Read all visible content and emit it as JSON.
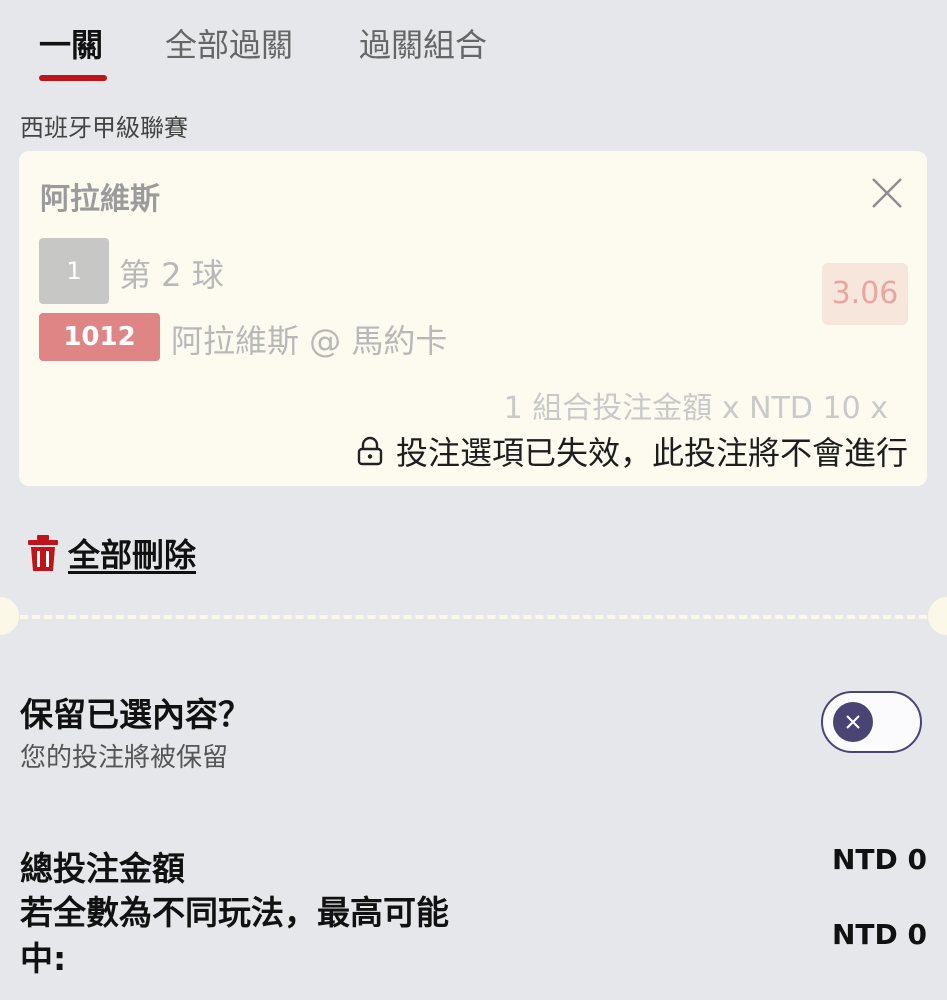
{
  "tabs": [
    {
      "label": "一關",
      "active": true
    },
    {
      "label": "全部過關",
      "active": false
    },
    {
      "label": "過關組合",
      "active": false
    }
  ],
  "league": "西班牙甲級聯賽",
  "bet_card": {
    "team": "阿拉維斯",
    "selection_badge": "1",
    "selection_text": "第 2 球",
    "odds": "3.06",
    "match_code": "1012",
    "match_text": "阿拉維斯 @ 馬約卡",
    "stake_line": "1 組合投注金額 x NTD 10 x",
    "invalid_notice": "投注選項已失效，此投注將不會進行"
  },
  "delete_all_label": "全部刪除",
  "keep_selection": {
    "title": "保留已選內容？",
    "subtitle": "您的投注將被保留",
    "toggle_on": false
  },
  "totals": {
    "total_stake_label": "總投注金額",
    "total_stake_value": "NTD 0",
    "max_win_label": "若全數為不同玩法，最高可能中:",
    "max_win_value": "NTD 0"
  },
  "colors": {
    "accent_red": "#c0141b",
    "toggle_purple": "#4a4475",
    "card_bg": "#fdfbef"
  },
  "icons": [
    "close-icon",
    "lock-icon",
    "trash-icon",
    "x-icon"
  ]
}
